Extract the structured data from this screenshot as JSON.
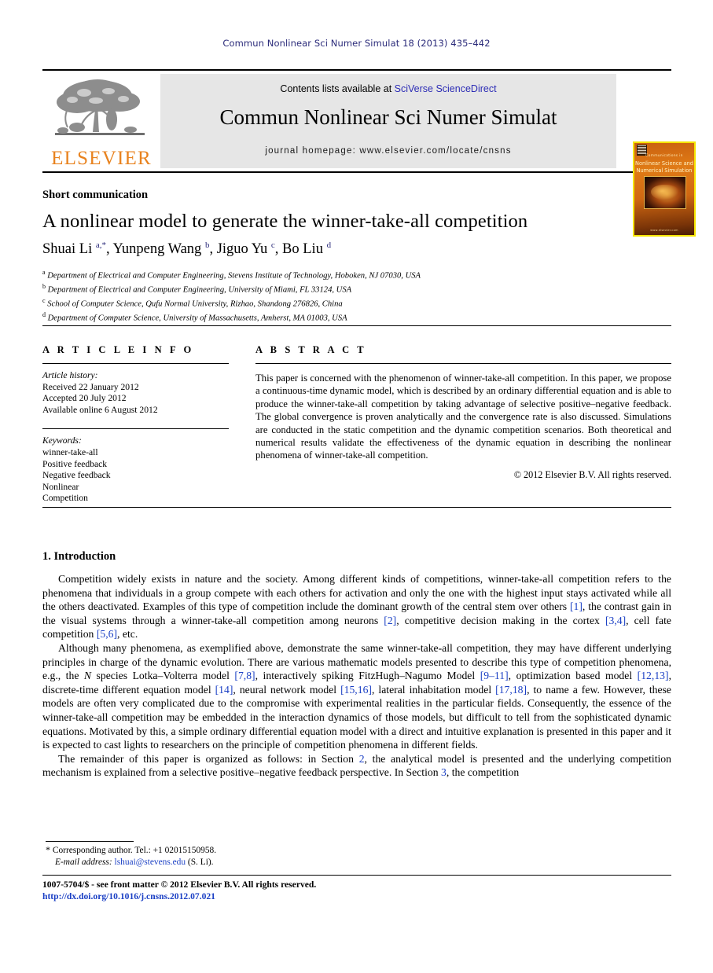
{
  "running_head": "Commun Nonlinear Sci Numer Simulat 18 (2013) 435–442",
  "masthead": {
    "contents_prefix": "Contents lists available at ",
    "contents_link": "SciVerse ScienceDirect",
    "journal_title": "Commun Nonlinear Sci Numer Simulat",
    "homepage": "journal homepage: www.elsevier.com/locate/cnsns",
    "publisher_name": "ELSEVIER",
    "cover": {
      "line1": "Communications in",
      "line2": "Nonlinear Science and",
      "line3": "Numerical Simulation",
      "footer": "www.elsevier.com"
    }
  },
  "article": {
    "section_type": "Short communication",
    "title": "A nonlinear model to generate the winner-take-all competition",
    "authors_html": "Shuai Li <sup>a,*</sup>, Yunpeng Wang <sup>b</sup>, Jiguo Yu <sup>c</sup>, Bo Liu <sup>d</sup>",
    "affiliations": [
      {
        "marker": "a",
        "text": "Department of Electrical and Computer Engineering, Stevens Institute of Technology, Hoboken, NJ 07030, USA"
      },
      {
        "marker": "b",
        "text": "Department of Electrical and Computer Engineering, University of Miami, FL 33124, USA"
      },
      {
        "marker": "c",
        "text": "School of Computer Science, Qufu Normal University, Rizhao, Shandong 276826, China"
      },
      {
        "marker": "d",
        "text": "Department of Computer Science, University of Massachusetts, Amherst, MA 01003, USA"
      }
    ]
  },
  "article_info": {
    "heading": "A R T I C L E    I N F O",
    "history_label": "Article history:",
    "history": [
      "Received 22 January 2012",
      "Accepted 20 July 2012",
      "Available online 6 August 2012"
    ],
    "keywords_label": "Keywords:",
    "keywords": [
      "winner-take-all",
      "Positive feedback",
      "Negative feedback",
      "Nonlinear",
      "Competition"
    ]
  },
  "abstract": {
    "heading": "A B S T R A C T",
    "text": "This paper is concerned with the phenomenon of winner-take-all competition. In this paper, we propose a continuous-time dynamic model, which is described by an ordinary differential equation and is able to produce the winner-take-all competition by taking advantage of selective positive–negative feedback. The global convergence is proven analytically and the convergence rate is also discussed. Simulations are conducted in the static competition and the dynamic competition scenarios. Both theoretical and numerical results validate the effectiveness of the dynamic equation in describing the nonlinear phenomena of winner-take-all competition.",
    "copyright": "© 2012 Elsevier B.V. All rights reserved."
  },
  "body": {
    "section_heading": "1. Introduction",
    "paragraph1_html": "Competition widely exists in nature and the society. Among different kinds of competitions, winner-take-all competition refers to the phenomena that individuals in a group compete with each others for activation and only the one with the highest input stays activated while all the others deactivated. Examples of this type of competition include the dominant growth of the central stem over others <span class=\"ref\">[1]</span>, the contrast gain in the visual systems through a winner-take-all competition among neurons <span class=\"ref\">[2]</span>, competitive decision making in the cortex <span class=\"ref\">[3,4]</span>, cell fate competition <span class=\"ref\">[5,6]</span>, etc.",
    "paragraph2_html": "Although many phenomena, as exemplified above, demonstrate the same winner-take-all competition, they may have different underlying principles in charge of the dynamic evolution. There are various mathematic models presented to describe this type of competition phenomena, e.g., the <span class=\"ital\">N</span> species Lotka–Volterra model <span class=\"ref\">[7,8]</span>, interactively spiking FitzHugh–Nagumo Model <span class=\"ref\">[9–11]</span>, optimization based model <span class=\"ref\">[12,13]</span>, discrete-time different equation model <span class=\"ref\">[14]</span>, neural network model <span class=\"ref\">[15,16]</span>, lateral inhabitation model <span class=\"ref\">[17,18]</span>, to name a few. However, these models are often very complicated due to the compromise with experimental realities in the particular fields. Consequently, the essence of the winner-take-all competition may be embedded in the interaction dynamics of those models, but difficult to tell from the sophisticated dynamic equations. Motivated by this, a simple ordinary differential equation model with a direct and intuitive explanation is presented in this paper and it is expected to cast lights to researchers on the principle of competition phenomena in different fields.",
    "paragraph3_html": "The remainder of this paper is organized as follows: in Section <span class=\"ref\">2</span>, the analytical model is presented and the underlying competition mechanism is explained from a selective positive–negative feedback perspective. In Section <span class=\"ref\">3</span>, the competition"
  },
  "footnote": {
    "marker": "*",
    "corresponding": "Corresponding author. Tel.: +1 02015150958.",
    "email_label": "E-mail address:",
    "email": "lshuai@stevens.edu",
    "email_suffix": "(S. Li)."
  },
  "imprint": {
    "line1": "1007-5704/$ - see front matter © 2012 Elsevier B.V. All rights reserved.",
    "doi": "http://dx.doi.org/10.1016/j.cnsns.2012.07.021"
  }
}
